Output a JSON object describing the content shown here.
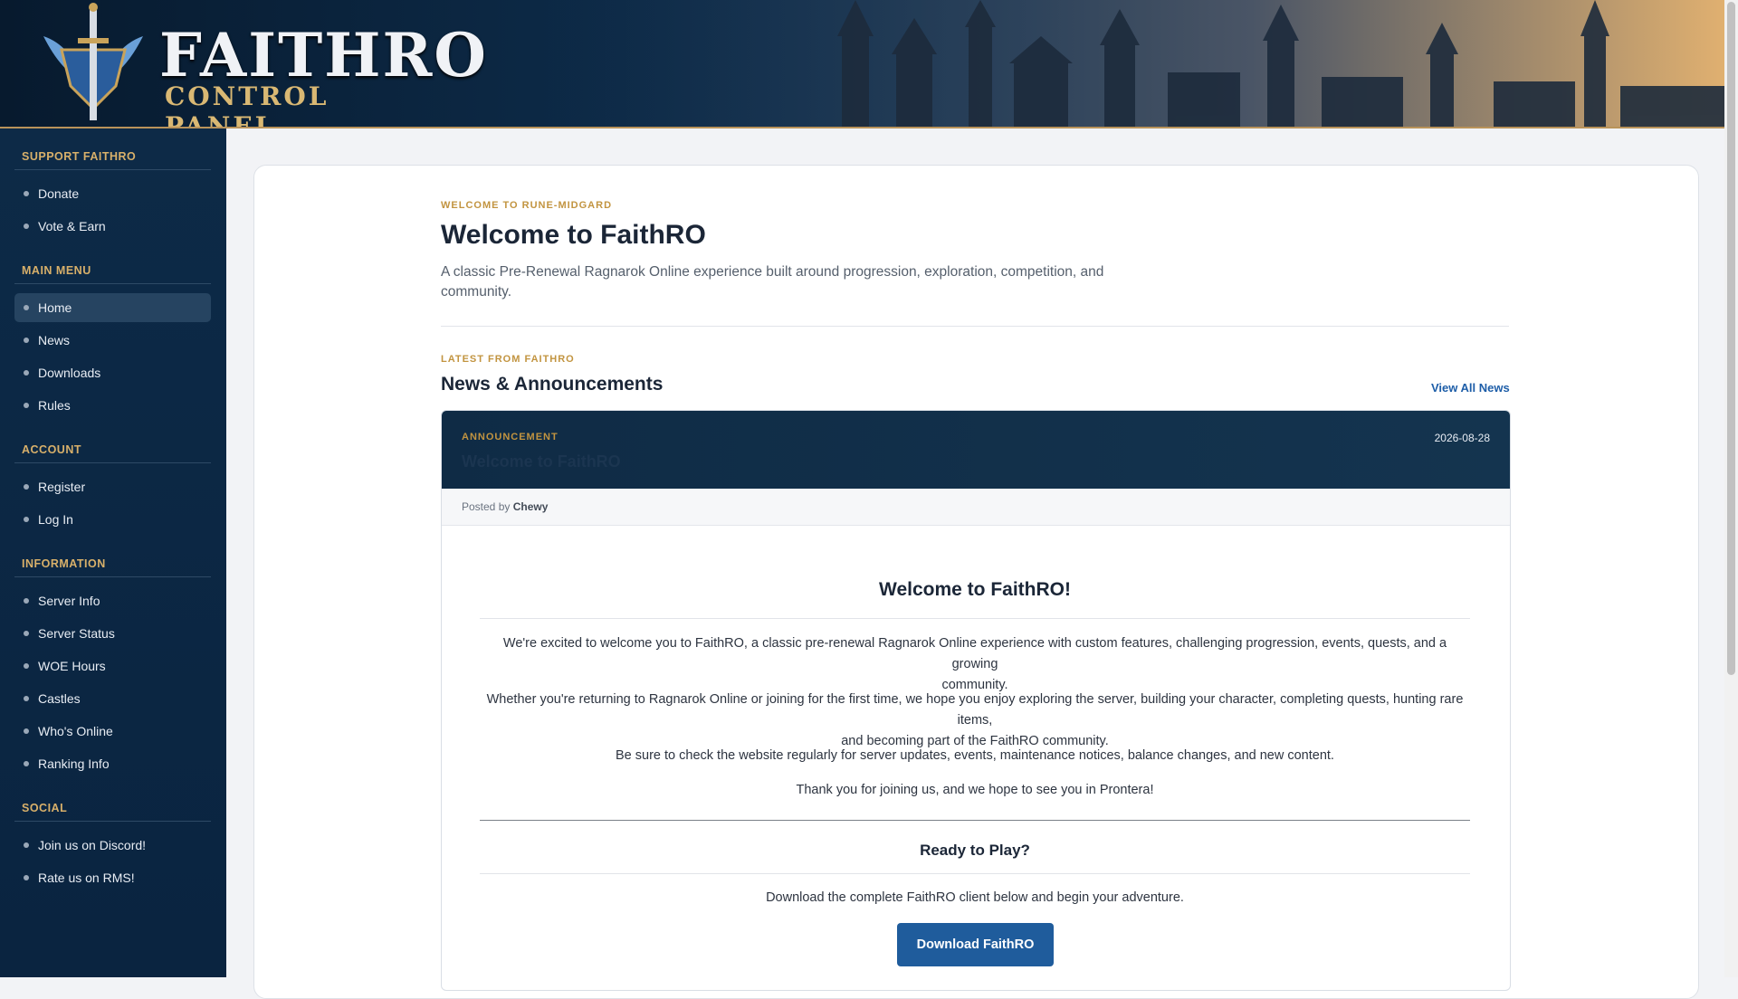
{
  "header": {
    "logo_title": "FAITHRO",
    "logo_subtitle": "CONTROL PANEL"
  },
  "sidebar": {
    "sections": [
      {
        "title": "SUPPORT FAITHRO",
        "items": [
          "Donate",
          "Vote & Earn"
        ]
      },
      {
        "title": "MAIN MENU",
        "items": [
          "Home",
          "News",
          "Downloads",
          "Rules"
        ]
      },
      {
        "title": "ACCOUNT",
        "items": [
          "Register",
          "Log In"
        ]
      },
      {
        "title": "INFORMATION",
        "items": [
          "Server Info",
          "Server Status",
          "WOE Hours",
          "Castles",
          "Who's Online",
          "Ranking Info"
        ]
      },
      {
        "title": "SOCIAL",
        "items": [
          "Join us on Discord!",
          "Rate us on RMS!"
        ]
      }
    ],
    "active_item": "Home"
  },
  "hero": {
    "eyebrow": "WELCOME TO RUNE-MIDGARD",
    "title": "Welcome to FaithRO",
    "lead_line1": "A classic Pre-Renewal Ragnarok Online experience built around progression, exploration, competition, and",
    "lead_line2": "community."
  },
  "news": {
    "eyebrow": "LATEST FROM FAITHRO",
    "title": "News & Announcements",
    "view_all": "View All News",
    "post": {
      "category": "ANNOUNCEMENT",
      "date": "2026-08-28",
      "title": "Welcome to FaithRO",
      "posted_by_label": "Posted by",
      "author": "Chewy",
      "heading": "Welcome to FaithRO!",
      "p1_line1": "We're excited to welcome you to FaithRO, a classic pre-renewal Ragnarok Online experience with custom features, challenging progression, events, quests, and a growing",
      "p1_line2": "community.",
      "p2_line1": "Whether you're returning to Ragnarok Online or joining for the first time, we hope you enjoy exploring the server, building your character, completing quests, hunting rare items,",
      "p2_line2": "and becoming part of the FaithRO community.",
      "p3": "Be sure to check the website regularly for server updates, events, maintenance notices, balance changes, and new content.",
      "p4": "Thank you for joining us, and we hope to see you in Prontera!",
      "cta_heading": "Ready to Play?",
      "cta_text": "Download the complete FaithRO client below and begin your adventure.",
      "cta_button": "Download FaithRO"
    }
  }
}
